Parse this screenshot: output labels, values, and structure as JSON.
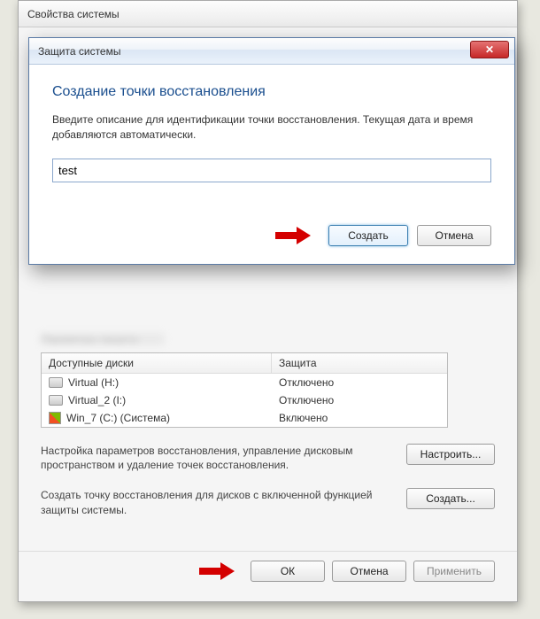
{
  "parent": {
    "title": "Свойства системы",
    "section_blur": "Параметры защиты",
    "disk_table": {
      "header_disks": "Доступные диски",
      "header_protection": "Защита",
      "rows": [
        {
          "name": "Virtual (H:)",
          "status": "Отключено",
          "icon": "hdd"
        },
        {
          "name": "Virtual_2 (I:)",
          "status": "Отключено",
          "icon": "hdd"
        },
        {
          "name": "Win_7 (C:) (Система)",
          "status": "Включено",
          "icon": "win"
        }
      ]
    },
    "config_text": "Настройка параметров восстановления, управление дисковым пространством и удаление точек восстановления.",
    "config_button": "Настроить...",
    "create_text": "Создать точку восстановления для дисков с включенной функцией защиты системы.",
    "create_button": "Создать...",
    "ok": "ОК",
    "cancel": "Отмена",
    "apply": "Применить"
  },
  "modal": {
    "title": "Защита системы",
    "close": "✕",
    "heading": "Создание точки восстановления",
    "description": "Введите описание для идентификации точки восстановления. Текущая дата и время добавляются автоматически.",
    "input_value": "test",
    "create": "Создать",
    "cancel": "Отмена"
  }
}
